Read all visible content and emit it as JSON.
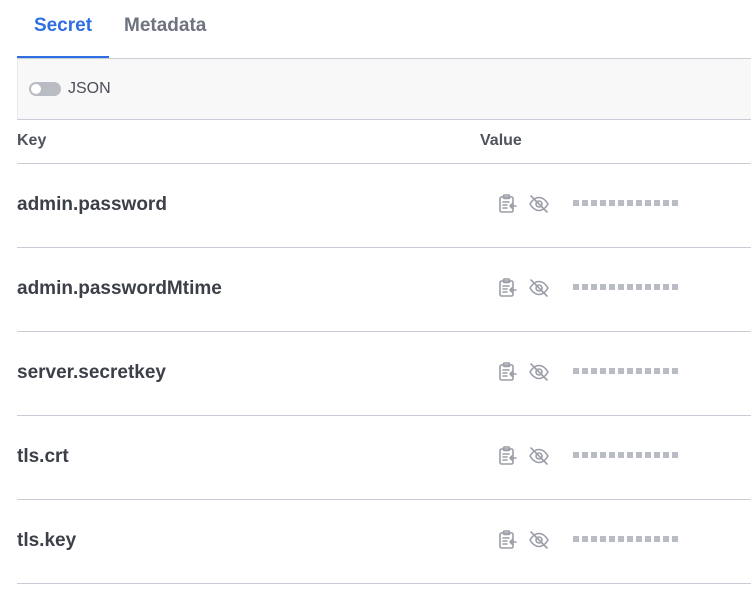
{
  "tabs": [
    {
      "label": "Secret",
      "active": true
    },
    {
      "label": "Metadata",
      "active": false
    }
  ],
  "toolbar": {
    "json_toggle_label": "JSON",
    "json_toggle_on": false
  },
  "table": {
    "columns": {
      "key": "Key",
      "value": "Value"
    },
    "rows": [
      {
        "key": "admin.password",
        "value_masked": "••••••••••••"
      },
      {
        "key": "admin.passwordMtime",
        "value_masked": "••••••••••••"
      },
      {
        "key": "server.secretkey",
        "value_masked": "••••••••••••"
      },
      {
        "key": "tls.crt",
        "value_masked": "••••••••••••"
      },
      {
        "key": "tls.key",
        "value_masked": "••••••••••••"
      }
    ],
    "row_icons": [
      "copy-to-clipboard-icon",
      "eye-slash-icon"
    ]
  },
  "colors": {
    "accent": "#2f6fe4",
    "muted": "#b9bcc3"
  }
}
